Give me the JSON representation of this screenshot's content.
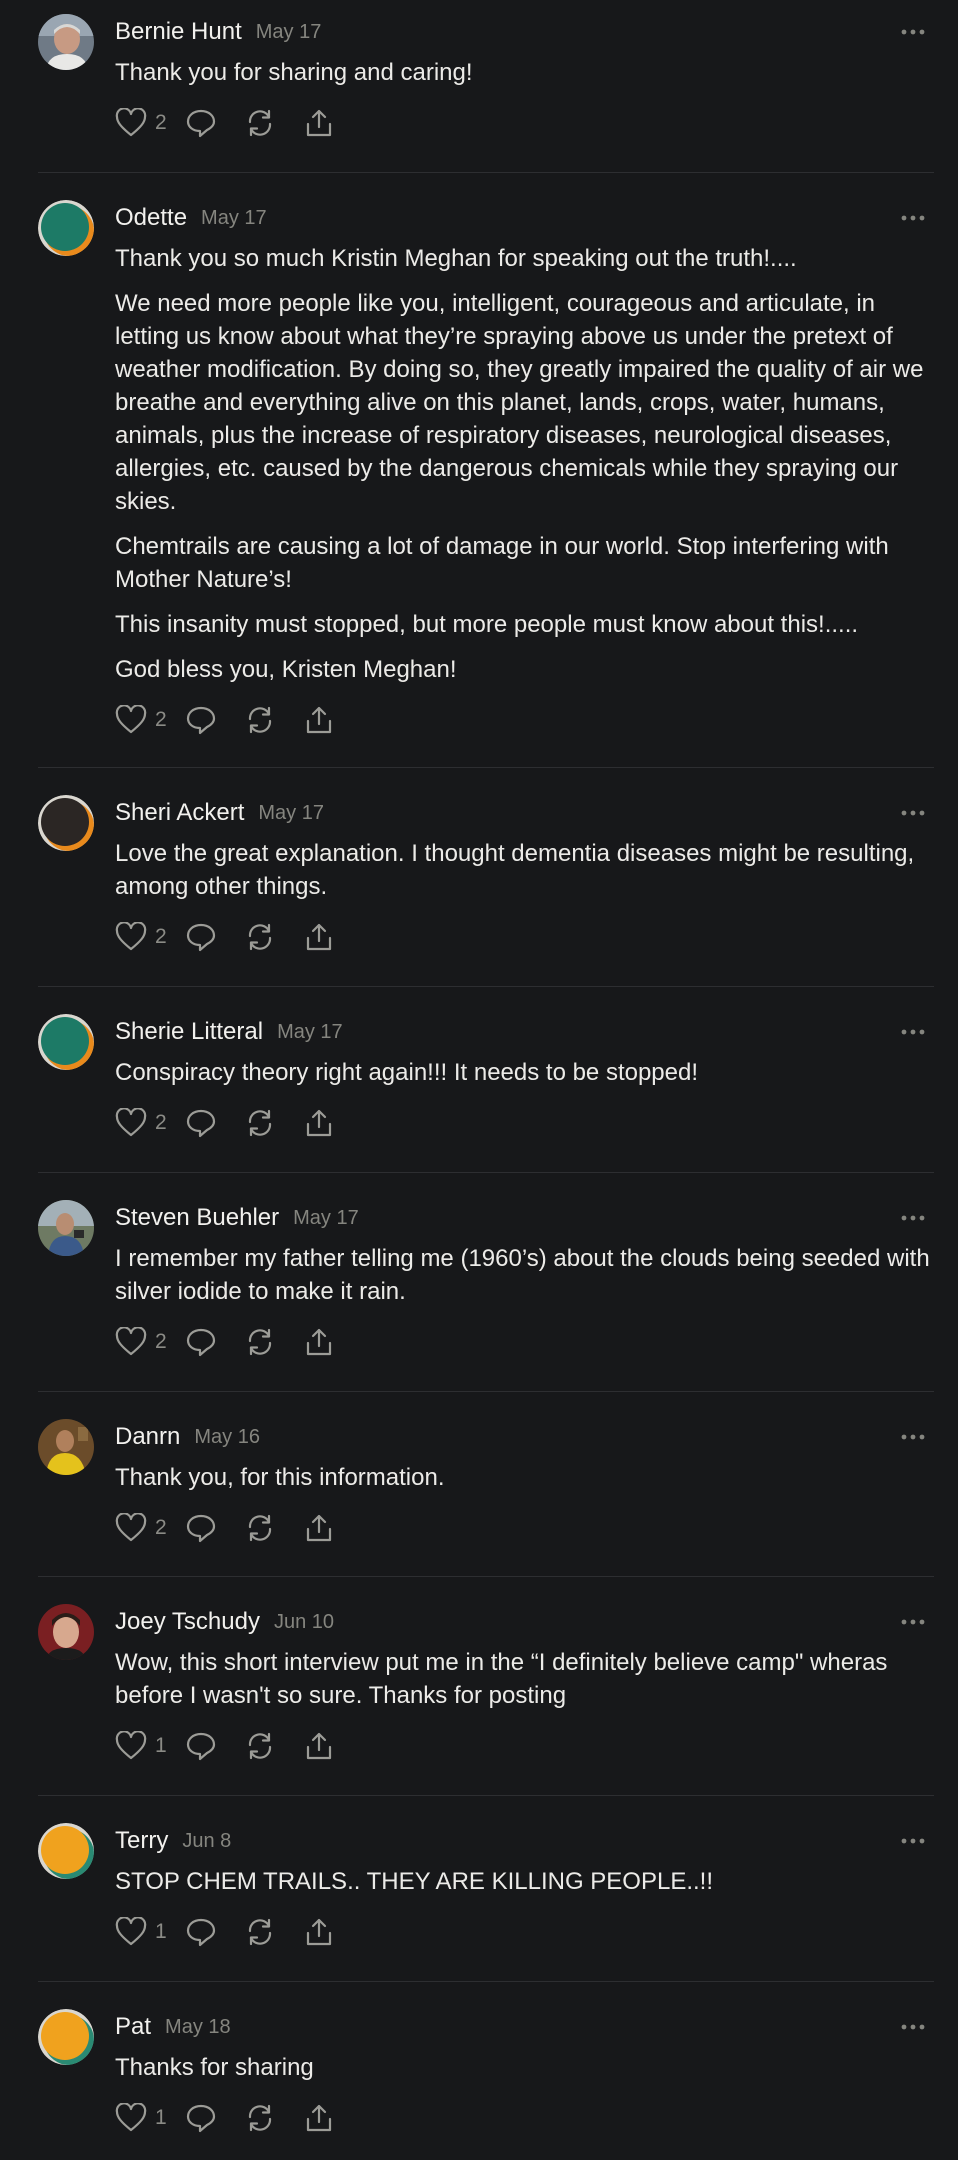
{
  "colors": {
    "background": "#17181a",
    "text": "#ecebe8",
    "muted": "#85857f",
    "icon": "#9c9c97",
    "divider": "#2d2e31"
  },
  "icons": {
    "like": "heart-icon",
    "reply": "speech-bubble-icon",
    "restack": "restack-arrows-icon",
    "share": "share-upload-icon",
    "more": "ellipsis-icon"
  },
  "comments": [
    {
      "author": "Bernie Hunt",
      "date": "May 17",
      "avatar": "photo-man-gray-hair",
      "paragraphs": [
        "Thank you for sharing and caring!"
      ],
      "likes": "2"
    },
    {
      "author": "Odette",
      "date": "May 17",
      "avatar": "default-teal",
      "paragraphs": [
        "Thank you so much Kristin Meghan for speaking out the truth!....",
        "We need more people like you, intelligent, courageous and articulate, in letting us know about what they’re spraying above us under the pretext of weather modification. By doing so, they greatly impaired the quality of air we breathe and everything alive on this planet, lands, crops, water, humans, animals, plus the increase of respiratory diseases, neurological diseases, allergies, etc. caused by the dangerous chemicals while they spraying our skies.",
        "Chemtrails are causing a lot of damage in our world. Stop interfering with Mother Nature’s!",
        "This insanity must stopped, but more people must know about this!.....",
        "God bless you, Kristen Meghan!"
      ],
      "likes": "2"
    },
    {
      "author": "Sheri Ackert",
      "date": "May 17",
      "avatar": "default-dark",
      "paragraphs": [
        "Love the great explanation. I thought dementia diseases might be resulting, among other things."
      ],
      "likes": "2"
    },
    {
      "author": "Sherie Litteral",
      "date": "May 17",
      "avatar": "default-teal",
      "paragraphs": [
        "Conspiracy theory right again!!! It needs to be stopped!"
      ],
      "likes": "2"
    },
    {
      "author": "Steven Buehler",
      "date": "May 17",
      "avatar": "photo-man-outdoors",
      "paragraphs": [
        "I remember my father telling me (1960’s) about the clouds being seeded with silver iodide to make it rain."
      ],
      "likes": "2"
    },
    {
      "author": "Danrn",
      "date": "May 16",
      "avatar": "photo-person-yellow-shirt",
      "paragraphs": [
        "Thank you, for this information."
      ],
      "likes": "2"
    },
    {
      "author": "Joey Tschudy",
      "date": "Jun 10",
      "avatar": "photo-man-dark-hair",
      "paragraphs": [
        "Wow, this short interview put me in the “I definitely believe camp\" wheras before I wasn't so sure. Thanks for posting"
      ],
      "likes": "1"
    },
    {
      "author": "Terry",
      "date": "Jun 8",
      "avatar": "default-orange",
      "paragraphs": [
        "STOP CHEM TRAILS.. THEY ARE KILLING PEOPLE..!!"
      ],
      "likes": "1"
    },
    {
      "author": "Pat",
      "date": "May 18",
      "avatar": "default-orange",
      "paragraphs": [
        "Thanks for sharing"
      ],
      "likes": "1"
    }
  ]
}
